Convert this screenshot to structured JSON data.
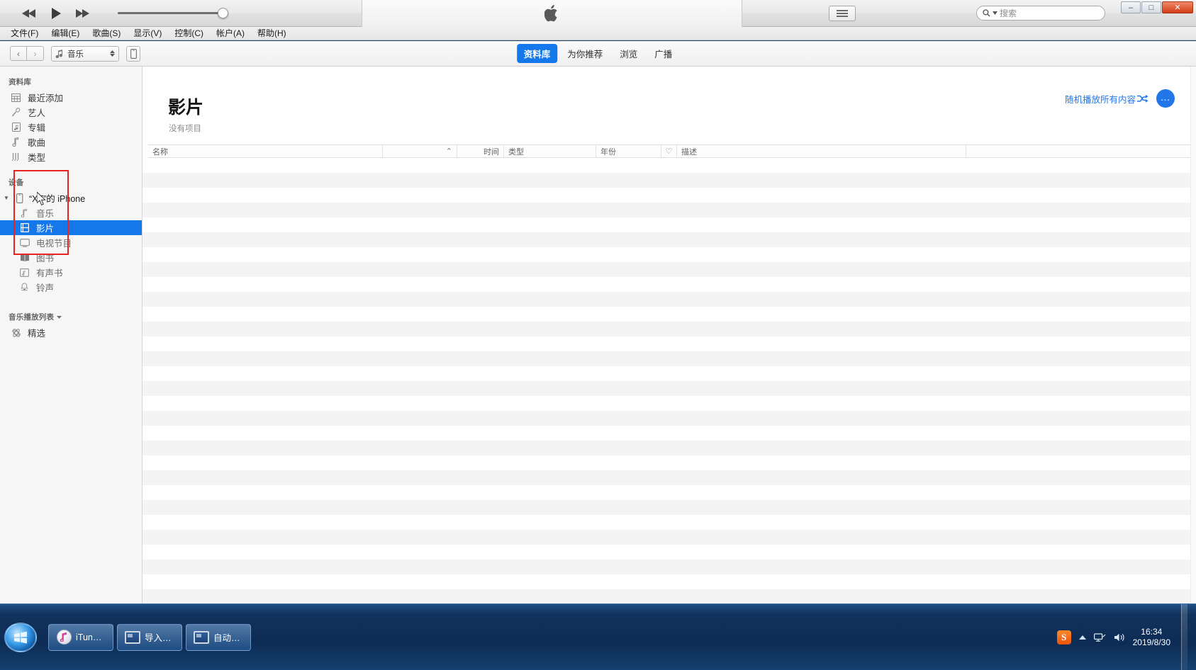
{
  "window": {
    "minimize_label": "–",
    "maximize_label": "□",
    "close_label": "✕"
  },
  "transport": {
    "rewind": "rewind-icon",
    "play": "play-icon",
    "fastforward": "fast-forward-icon",
    "volume_value": "100"
  },
  "search": {
    "placeholder": "搜索"
  },
  "menubar": {
    "items": [
      {
        "label": "文件(F)"
      },
      {
        "label": "编辑(E)"
      },
      {
        "label": "歌曲(S)"
      },
      {
        "label": "显示(V)"
      },
      {
        "label": "控制(C)"
      },
      {
        "label": "帐户(A)"
      },
      {
        "label": "帮助(H)"
      }
    ]
  },
  "navbar": {
    "back": "‹",
    "forward": "›",
    "media_selector": "音乐",
    "tabs": [
      {
        "label": "资料库",
        "active": true
      },
      {
        "label": "为你推荐",
        "active": false
      },
      {
        "label": "浏览",
        "active": false
      },
      {
        "label": "广播",
        "active": false
      }
    ]
  },
  "sidebar": {
    "library_header": "资料库",
    "library_items": [
      {
        "label": "最近添加",
        "icon": "grid-icon"
      },
      {
        "label": "艺人",
        "icon": "microphone-icon"
      },
      {
        "label": "专辑",
        "icon": "album-icon"
      },
      {
        "label": "歌曲",
        "icon": "music-note-icon"
      },
      {
        "label": "类型",
        "icon": "genre-icon"
      }
    ],
    "devices_header": "设备",
    "device_name": "“XT”的 iPhone",
    "device_items": [
      {
        "label": "音乐",
        "icon": "music-note-icon",
        "selected": false
      },
      {
        "label": "影片",
        "icon": "film-icon",
        "selected": true
      },
      {
        "label": "电视节目",
        "icon": "tv-icon",
        "selected": false
      },
      {
        "label": "图书",
        "icon": "book-icon",
        "selected": false
      },
      {
        "label": "有声书",
        "icon": "audiobook-icon",
        "selected": false
      },
      {
        "label": "铃声",
        "icon": "bell-icon",
        "selected": false
      }
    ],
    "playlists_header": "音乐播放列表",
    "playlist_items": [
      {
        "label": "精选",
        "icon": "genius-icon"
      }
    ]
  },
  "main": {
    "title": "影片",
    "subtitle": "没有项目",
    "shuffle_label": "随机播放所有内容",
    "more_label": "…",
    "columns": [
      {
        "label": "名称",
        "key": "name"
      },
      {
        "label": "时间",
        "key": "time"
      },
      {
        "label": "类型",
        "key": "kind"
      },
      {
        "label": "年份",
        "key": "year"
      },
      {
        "label": "♡",
        "key": "love"
      },
      {
        "label": "描述",
        "key": "desc"
      }
    ],
    "sort_indicator": "⌃",
    "rows": []
  },
  "taskbar": {
    "items": [
      {
        "label": "iTun…",
        "icon": "itunes-icon"
      },
      {
        "label": "导入…",
        "icon": "monitor-icon"
      },
      {
        "label": "自动…",
        "icon": "monitor-icon"
      }
    ],
    "tray": {
      "sogou": "S",
      "expand": "▲",
      "network": "network-icon",
      "volume": "speaker-icon",
      "time": "16:34",
      "date": "2019/8/30"
    }
  },
  "colors": {
    "accent": "#1578ea",
    "link": "#2276e8",
    "highlight_box": "#e8241f"
  }
}
